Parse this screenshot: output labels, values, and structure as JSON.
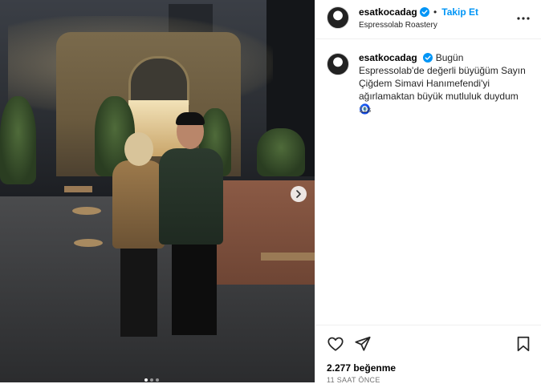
{
  "post": {
    "author": {
      "username": "esatkocadag",
      "verified": true,
      "avatar_icon": "avatar-icon"
    },
    "header": {
      "follow_label": "Takip Et",
      "location": "Espressolab Roastery",
      "more_icon": "more-options-icon"
    },
    "caption": {
      "text": "Bugün Espressolab'de değerli büyüğüm Sayın Çiğdem Simavi Hanımefendi'yi ağırlamaktan büyük mutluluk duydum",
      "emoji": "🧿",
      "time": "11s"
    },
    "media": {
      "carousel_total": 3,
      "carousel_active": 1,
      "next_icon": "chevron-right-icon"
    },
    "actions": {
      "like_icon": "heart-icon",
      "share_icon": "send-icon",
      "save_icon": "bookmark-icon"
    },
    "stats": {
      "likes": "2.277 beğenme",
      "time_ago": "11 SAAT ÖNCE"
    }
  },
  "colors": {
    "follow": "#0095f6",
    "verified": "#0095f6",
    "secondary_text": "#737373"
  }
}
